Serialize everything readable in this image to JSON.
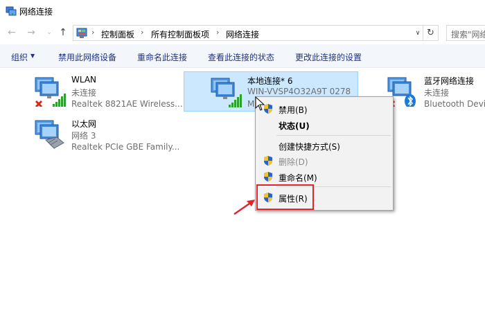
{
  "window": {
    "title": "网络连接"
  },
  "address": {
    "crumbs": [
      "控制面板",
      "所有控制面板项",
      "网络连接"
    ],
    "search_placeholder": "搜索\"网络连接\""
  },
  "toolbar": {
    "organize": "组织",
    "disable_device": "禁用此网络设备",
    "rename": "重命名此连接",
    "view_status": "查看此连接的状态",
    "change_settings": "更改此连接的设置"
  },
  "connections": [
    {
      "name": "WLAN",
      "status": "未连接",
      "device": "Realtek 8821AE Wireless...",
      "icon": "wifi-adapter-icon"
    },
    {
      "name": "本地连接* 6",
      "status": "WIN-VVSP4O32A9T 0278",
      "device": "M",
      "icon": "wifi-adapter-icon"
    },
    {
      "name": "蓝牙网络连接",
      "status": "未连接",
      "device": "Bluetooth Devic",
      "icon": "bluetooth-adapter-icon"
    },
    {
      "name": "以太网",
      "status": "网络 3",
      "device": "Realtek PCIe GBE Family...",
      "icon": "ethernet-adapter-icon"
    }
  ],
  "context_menu": {
    "disable": "禁用(B)",
    "status": "状态(U)",
    "create_shortcut": "创建快捷方式(S)",
    "delete": "删除(D)",
    "rename": "重命名(M)",
    "properties": "属性(R)"
  },
  "colors": {
    "accent": "#1e3287",
    "selection": "#cce8ff",
    "highlight_box": "#e0262b"
  }
}
